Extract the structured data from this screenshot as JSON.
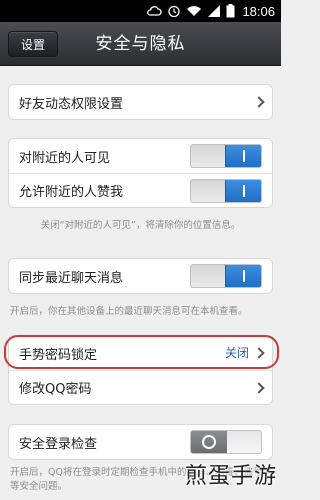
{
  "status_bar": {
    "time": "18:06",
    "icons": [
      "cloud-sync-icon",
      "alarm-icon",
      "wifi-icon",
      "signal-icon",
      "battery-icon"
    ]
  },
  "header": {
    "back_label": "设置",
    "title": "安全与隐私"
  },
  "sections": {
    "friend_dynamics": {
      "label": "好友动态权限设置"
    },
    "nearby": {
      "visible_label": "对附近的人可见",
      "visible_on": true,
      "like_label": "允许附近的人赞我",
      "like_on": true,
      "note": "关闭“对附近的人可见”，将清除你的位置信息。"
    },
    "sync": {
      "label": "同步最近聊天消息",
      "on": true,
      "note": "开启后，你在其他设备上的最近聊天消息可在本机查看。"
    },
    "password": {
      "gesture_label": "手势密码锁定",
      "gesture_value": "关闭",
      "modify_label": "修改QQ密码"
    },
    "login_check": {
      "label": "安全登录检查",
      "on": false,
      "note": "开启后，QQ将在登录时定期检查手机中的木马、病毒、盗号等安全问题。"
    }
  },
  "watermark": "煎蛋手游",
  "colors": {
    "accent_blue": "#2a64b8",
    "toggle_blue": "#1f6fc6",
    "highlight_red": "#c8393a"
  }
}
